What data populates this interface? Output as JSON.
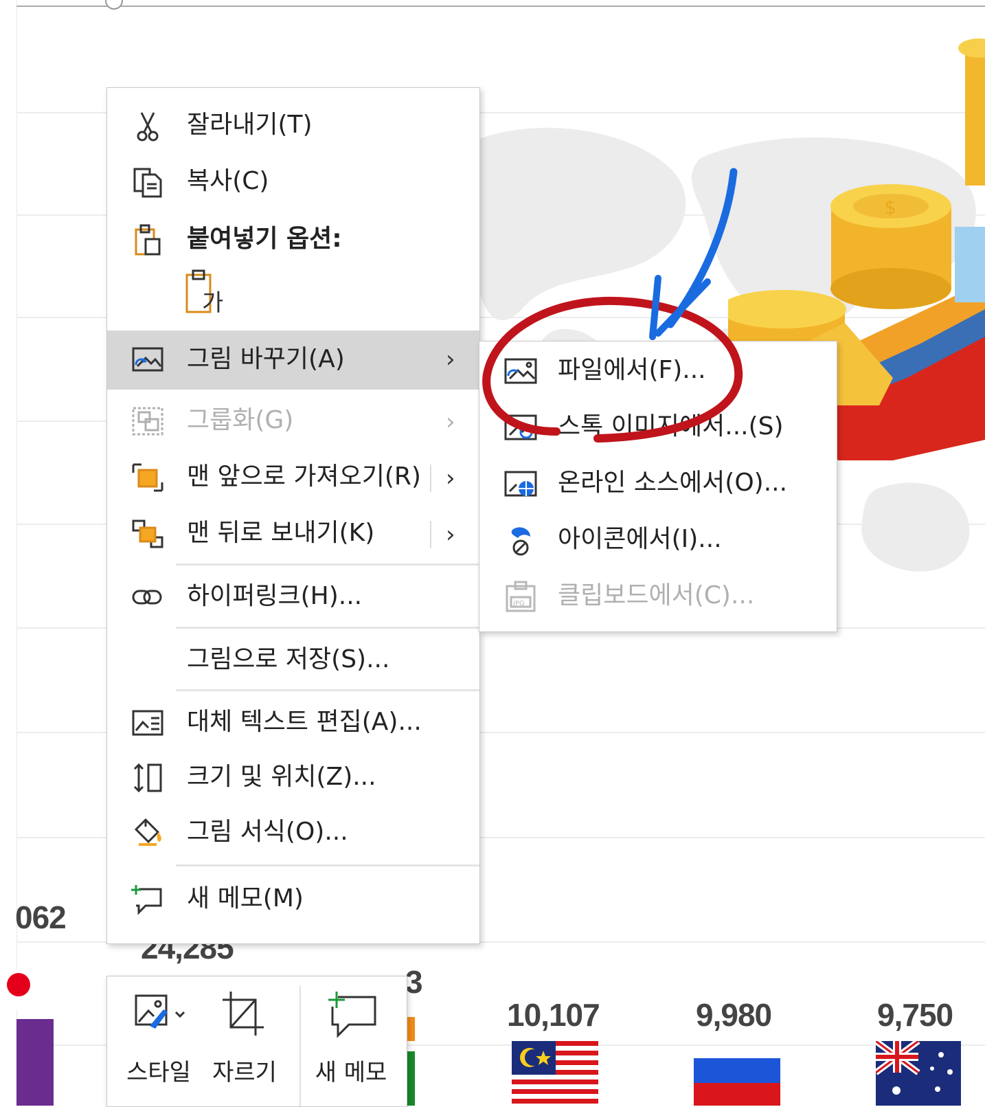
{
  "context_menu": {
    "cut": "잘라내기(T)",
    "copy": "복사(C)",
    "paste_options": "붙여넣기 옵션:",
    "change_picture": "그림 바꾸기(A)",
    "group": "그룹화(G)",
    "bring_to_front": "맨 앞으로 가져오기(R)",
    "send_to_back": "맨 뒤로 보내기(K)",
    "hyperlink": "하이퍼링크(H)...",
    "save_as_picture": "그림으로 저장(S)...",
    "edit_alt_text": "대체 텍스트 편집(A)...",
    "size_position": "크기 및 위치(Z)...",
    "format_picture": "그림 서식(O)...",
    "new_comment": "새 메모(M)"
  },
  "submenu": {
    "from_file": "파일에서(F)...",
    "stock_images": "스톡 이미지에서...(S)",
    "online_sources": "온라인 소스에서(O)...",
    "from_icons": "아이콘에서(I)...",
    "from_clipboard": "클립보드에서(C)..."
  },
  "mini_toolbar": {
    "style": "스타일",
    "crop": "자르기",
    "new_comment": "새 메모"
  },
  "slide_values": {
    "v1": "062",
    "v2": "24,285",
    "v3": "3",
    "v4": "10,107",
    "v5": "9,980",
    "v6": "9,750"
  },
  "colors": {
    "menu_highlight": "#d6d6d6",
    "disabled_text": "#b0b0b0",
    "annotation_circle": "#c0141c",
    "annotation_arrow": "#1a6be0",
    "coin_gold": "#f5c23c"
  }
}
